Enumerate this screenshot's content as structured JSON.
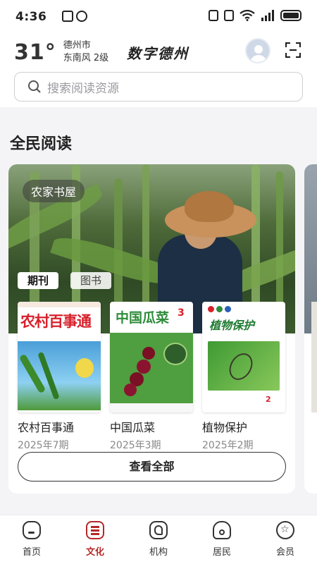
{
  "status_bar": {
    "time": "4:36"
  },
  "header": {
    "temperature": "31°",
    "city": "德州市",
    "wind": "东南风  2级",
    "app_title": "数字德州"
  },
  "search": {
    "placeholder": "搜索阅读资源"
  },
  "section": {
    "title": "全民阅读"
  },
  "card": {
    "badge": "农家书屋",
    "tabs": [
      {
        "label": "期刊",
        "active": true
      },
      {
        "label": "图书",
        "active": false
      }
    ],
    "magazines": [
      {
        "name": "农村百事通",
        "issue": "2025年7期",
        "cover_title": "农村百事通",
        "cover_color": "#d8202b"
      },
      {
        "name": "中国瓜菜",
        "issue": "2025年3期",
        "cover_title": "中国瓜菜",
        "cover_color": "#2e8c3a"
      },
      {
        "name": "植物保护",
        "issue": "2025年2期",
        "cover_title": "植物保护",
        "cover_color": "#1f7a33"
      }
    ],
    "view_all_label": "查看全部"
  },
  "bottom_nav": [
    {
      "label": "首页",
      "icon": "home-icon",
      "active": false
    },
    {
      "label": "文化",
      "icon": "culture-icon",
      "active": true
    },
    {
      "label": "机构",
      "icon": "institution-icon",
      "active": false
    },
    {
      "label": "居民",
      "icon": "resident-icon",
      "active": false
    },
    {
      "label": "会员",
      "icon": "member-icon",
      "active": false
    }
  ],
  "colors": {
    "accent": "#b62828"
  }
}
